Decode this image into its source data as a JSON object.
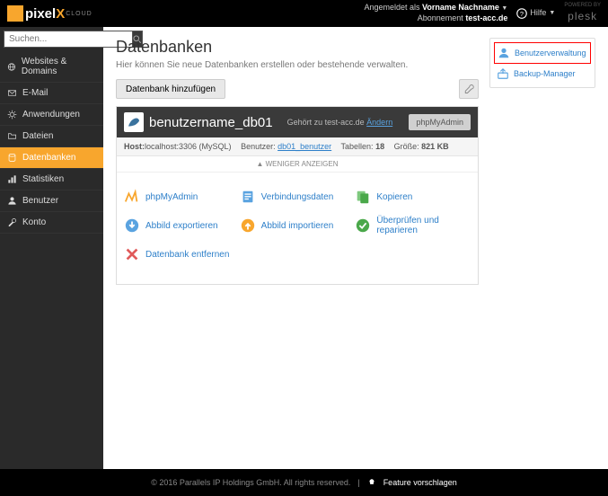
{
  "header": {
    "logo_main": "pixel",
    "logo_sub": "CLOUD",
    "logged_in_prefix": "Angemeldet als",
    "username": "Vorname Nachname",
    "subscription_prefix": "Abonnement",
    "subscription": "test-acc.de",
    "help_label": "Hilfe",
    "powered_prefix": "POWERED BY",
    "powered": "plesk"
  },
  "sidebar": {
    "search_placeholder": "Suchen...",
    "items": [
      {
        "label": "Websites & Domains"
      },
      {
        "label": "E-Mail"
      },
      {
        "label": "Anwendungen"
      },
      {
        "label": "Dateien"
      },
      {
        "label": "Datenbanken"
      },
      {
        "label": "Statistiken"
      },
      {
        "label": "Benutzer"
      },
      {
        "label": "Konto"
      }
    ]
  },
  "page": {
    "title": "Datenbanken",
    "subtitle": "Hier können Sie neue Datenbanken erstellen oder bestehende verwalten.",
    "btn_add": "Datenbank hinzufügen"
  },
  "db": {
    "name": "benutzername_db01",
    "domain_prefix": "Gehört zu test-acc.de",
    "domain_change": "Ändern",
    "btn_phpmyadmin": "phpMyAdmin",
    "host_label": "Host:",
    "host_value": "localhost:3306 (MySQL)",
    "users_label": "Benutzer:",
    "users_value": "db01_benutzer",
    "tables_label": "Tabellen:",
    "tables_value": "18",
    "size_label": "Größe:",
    "size_value": "821 KB",
    "toggle": "WENIGER ANZEIGEN",
    "actions": {
      "phpmyadmin": "phpMyAdmin",
      "connection": "Verbindungsdaten",
      "copy": "Kopieren",
      "export": "Abbild exportieren",
      "import": "Abbild importieren",
      "verify": "Überprüfen und reparieren",
      "remove": "Datenbank entfernen"
    }
  },
  "rightcol": {
    "user_mgmt": "Benutzerverwaltung",
    "backup_mgr": "Backup-Manager"
  },
  "footer": {
    "copyright": "© 2016 Parallels IP Holdings GmbH. All rights reserved.",
    "suggest": "Feature vorschlagen"
  }
}
